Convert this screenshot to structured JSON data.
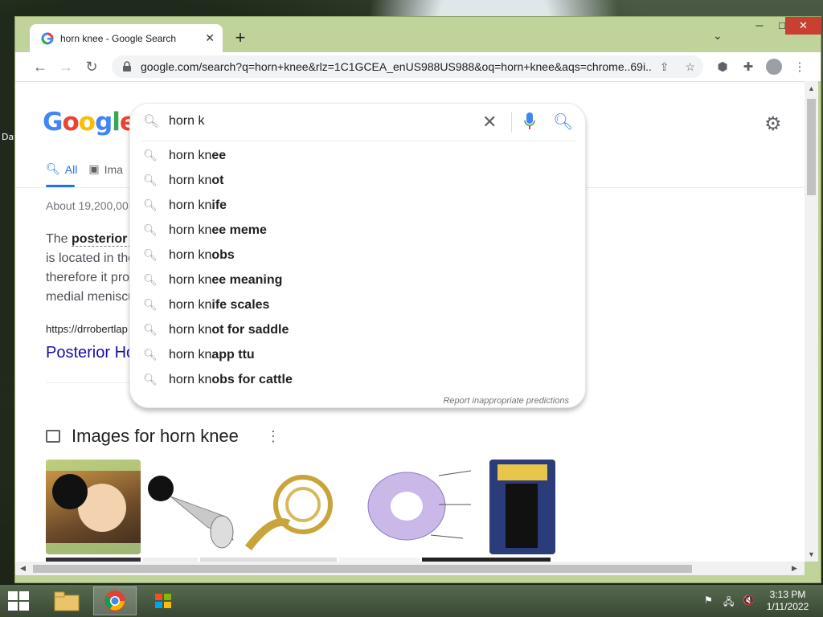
{
  "desktop": {
    "side_label": "Dat"
  },
  "browser": {
    "tab_title": "horn knee - Google Search",
    "url": "google.com/search?q=horn+knee&rlz=1C1GCEA_enUS988US988&oq=horn+knee&aqs=chrome..69i..."
  },
  "page": {
    "logo": [
      "G",
      "o",
      "o",
      "g",
      "l",
      "e"
    ],
    "logo_colors": [
      "#4285f4",
      "#ea4335",
      "#fbbc05",
      "#4285f4",
      "#34a853",
      "#ea4335"
    ],
    "tabs": [
      {
        "label": "All",
        "icon": "search-icon"
      },
      {
        "label": "Ima",
        "icon": "image-icon"
      }
    ],
    "result_stats": "About 19,200,00",
    "snippet": {
      "prefix": "The ",
      "bold": "posterior h",
      "lines": [
        "is located in the",
        "therefore it pro",
        "medial meniscu"
      ]
    },
    "cite": "https://drrobertlap",
    "result_title": "Posterior Ho",
    "images_heading": "Images for horn knee"
  },
  "search": {
    "query": "horn k",
    "suggestions": [
      {
        "typed": "horn kn",
        "completion": "ee"
      },
      {
        "typed": "horn kn",
        "completion": "ot"
      },
      {
        "typed": "horn kn",
        "completion": "ife"
      },
      {
        "typed": "horn kn",
        "completion": "ee meme"
      },
      {
        "typed": "horn kn",
        "completion": "obs"
      },
      {
        "typed": "horn kn",
        "completion": "ee meaning"
      },
      {
        "typed": "horn kn",
        "completion": "ife scales"
      },
      {
        "typed": "horn kn",
        "completion": "ot for saddle"
      },
      {
        "typed": "horn kn",
        "completion": "app ttu"
      },
      {
        "typed": "horn kn",
        "completion": "obs for cattle"
      }
    ],
    "report_text": "Report inappropriate predictions"
  },
  "colors": {
    "accent": "#1a73e8",
    "link": "#1a0dab",
    "window_frame": "#c0d39a",
    "close_button": "#c8402f"
  },
  "taskbar": {
    "time": "3:13 PM",
    "date": "1/11/2022"
  }
}
